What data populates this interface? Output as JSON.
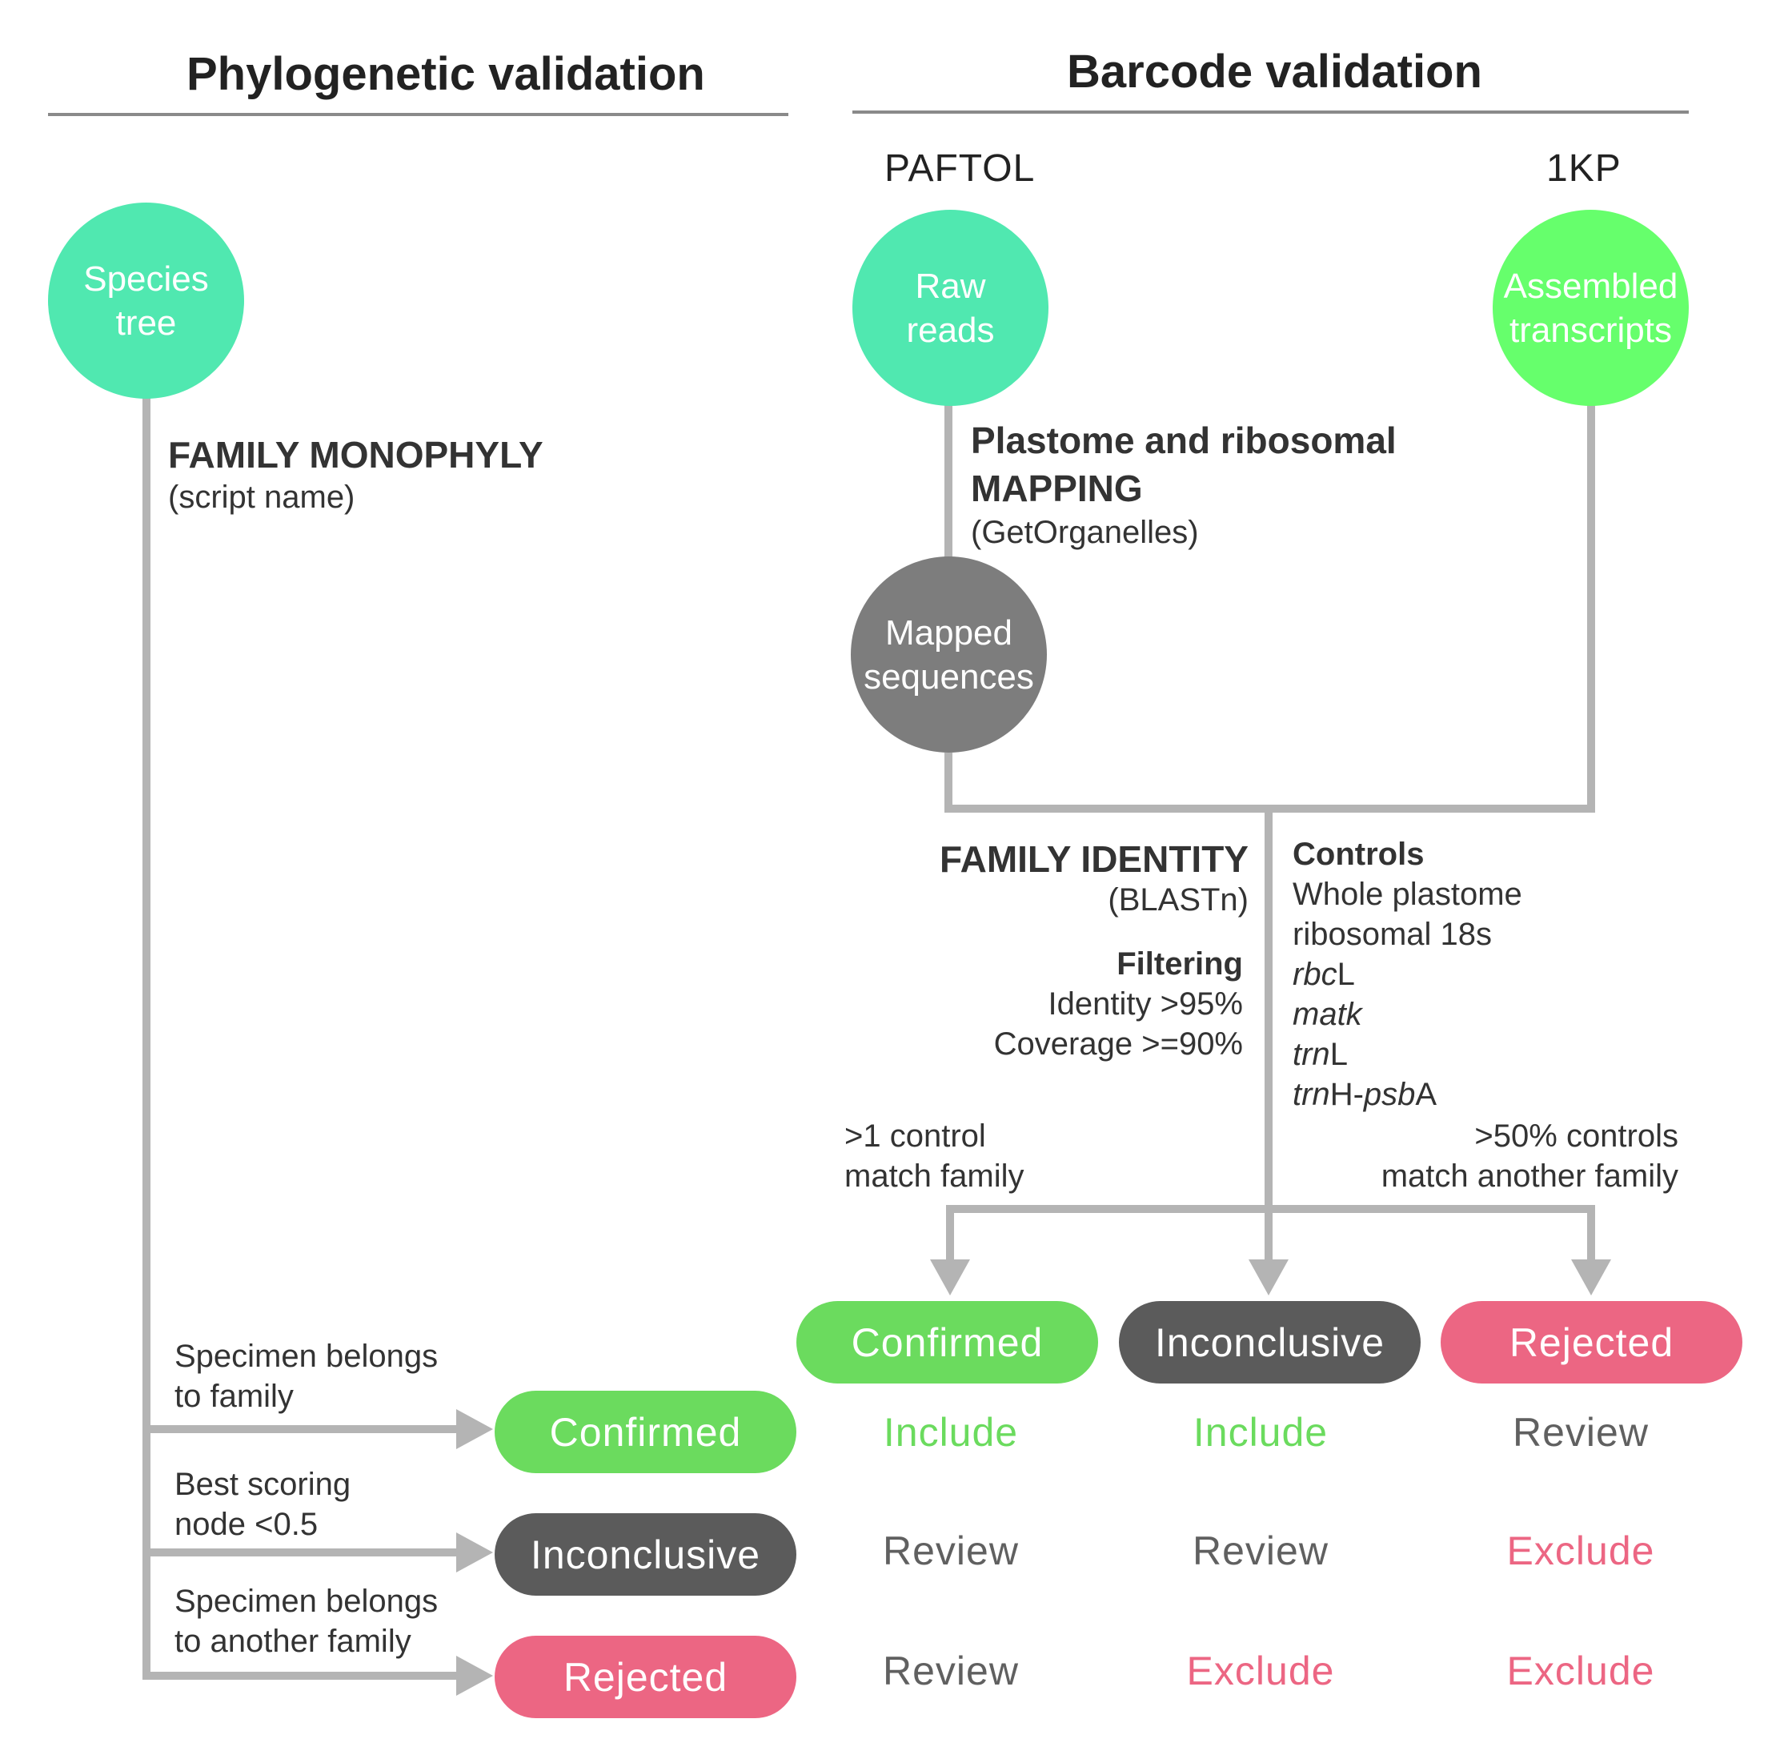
{
  "headings": {
    "phylo": "Phylogenetic validation",
    "barcode": "Barcode validation"
  },
  "sources": {
    "paftol": "PAFTOL",
    "onekp": "1KP"
  },
  "nodes": {
    "species_tree": "Species\ntree",
    "raw_reads": "Raw\nreads",
    "assembled": "Assembled\ntranscripts",
    "mapped": "Mapped\nsequences"
  },
  "steps": {
    "monophyly_title": "FAMILY MONOPHYLY",
    "monophyly_tool": "(script name)",
    "mapping_title_1": "Plastome and ribosomal",
    "mapping_title_2": "MAPPING",
    "mapping_tool": "(GetOrganelles)",
    "identity_title": "FAMILY IDENTITY",
    "identity_tool": "(BLASTn)"
  },
  "filtering": {
    "title": "Filtering",
    "items": [
      "Identity >95%",
      "Coverage >=90%"
    ]
  },
  "controls": {
    "title": "Controls",
    "items": [
      "Whole plastome",
      "ribosomal 18s",
      "rbcL",
      "matk",
      "trnL",
      "trnH-psbA"
    ]
  },
  "branch_labels": {
    "left_1": ">1 control",
    "left_2": "match family",
    "right_1": ">50% controls",
    "right_2": "match another family"
  },
  "phylo_conditions": {
    "c1_1": "Specimen belongs",
    "c1_2": "to family",
    "c2_1": "Best scoring",
    "c2_2": "node <0.5",
    "c3_1": "Specimen belongs",
    "c3_2": "to another family"
  },
  "outcomes": {
    "confirmed": "Confirmed",
    "inconclusive": "Inconclusive",
    "rejected": "Rejected"
  },
  "decision_matrix": [
    [
      "Include",
      "Include",
      "Review"
    ],
    [
      "Review",
      "Review",
      "Exclude"
    ],
    [
      "Review",
      "Exclude",
      "Exclude"
    ]
  ],
  "colors": {
    "teal": "#50e8b0",
    "green_node": "#66ff6c",
    "green": "#6bdb5e",
    "dark": "#5b5b5b",
    "mapped": "#7d7d7d",
    "pink": "#ec6683",
    "wire": "#b4b4b4",
    "include": "#6bdb5e",
    "review": "#606060",
    "exclude": "#ec6683"
  }
}
